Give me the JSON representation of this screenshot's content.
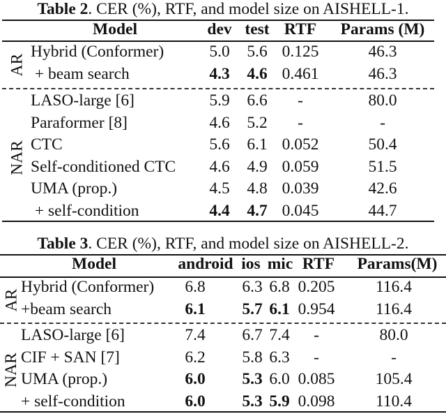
{
  "table2": {
    "caption_label": "Table 2",
    "caption_text": ". CER (%), RTF, and model size on AISHELL-1.",
    "headers": [
      "Model",
      "dev",
      "test",
      "RTF",
      "Params (M)"
    ],
    "groups": [
      {
        "label": "AR",
        "rows": [
          {
            "model": "Hybrid (Conformer)",
            "dev": "5.0",
            "test": "5.6",
            "rtf": "0.125",
            "params": "46.3",
            "bold": []
          },
          {
            "model": " + beam search",
            "dev": "4.3",
            "test": "4.6",
            "rtf": "0.461",
            "params": "46.3",
            "bold": [
              "dev",
              "test"
            ]
          }
        ]
      },
      {
        "label": "NAR",
        "rows": [
          {
            "model": "LASO-large [6]",
            "dev": "5.9",
            "test": "6.6",
            "rtf": "-",
            "params": "80.0",
            "bold": []
          },
          {
            "model": "Paraformer [8]",
            "dev": "4.6",
            "test": "5.2",
            "rtf": "-",
            "params": "-",
            "bold": []
          },
          {
            "model": "CTC",
            "dev": "5.6",
            "test": "6.1",
            "rtf": "0.052",
            "params": "50.4",
            "bold": []
          },
          {
            "model": "Self-conditioned CTC",
            "dev": "4.6",
            "test": "4.9",
            "rtf": "0.059",
            "params": "51.5",
            "bold": []
          },
          {
            "model": "UMA (prop.)",
            "dev": "4.5",
            "test": "4.8",
            "rtf": "0.039",
            "params": "42.6",
            "bold": []
          },
          {
            "model": " + self-condition",
            "dev": "4.4",
            "test": "4.7",
            "rtf": "0.045",
            "params": "44.7",
            "bold": [
              "dev",
              "test"
            ]
          }
        ]
      }
    ]
  },
  "table3": {
    "caption_label": "Table 3",
    "caption_text": ". CER (%), RTF, and model size on AISHELL-2.",
    "headers": [
      "Model",
      "android",
      "ios",
      "mic",
      "RTF",
      "Params(M)"
    ],
    "groups": [
      {
        "label": "AR",
        "rows": [
          {
            "model": "Hybrid (Conformer)",
            "android": "6.8",
            "ios": "6.3",
            "mic": "6.8",
            "rtf": "0.205",
            "params": "116.4",
            "bold": []
          },
          {
            "model": "+beam search",
            "android": "6.1",
            "ios": "5.7",
            "mic": "6.1",
            "rtf": "0.954",
            "params": "116.4",
            "bold": [
              "android",
              "ios",
              "mic"
            ]
          }
        ]
      },
      {
        "label": "NAR",
        "rows": [
          {
            "model": "LASO-large [6]",
            "android": "7.4",
            "ios": "6.7",
            "mic": "7.4",
            "rtf": "-",
            "params": "80.0",
            "bold": []
          },
          {
            "model": "CIF + SAN [7]",
            "android": "6.2",
            "ios": "5.8",
            "mic": "6.3",
            "rtf": "-",
            "params": "-",
            "bold": []
          },
          {
            "model": "UMA (prop.)",
            "android": "6.0",
            "ios": "5.3",
            "mic": "6.0",
            "rtf": "0.085",
            "params": "105.4",
            "bold": [
              "android",
              "ios"
            ]
          },
          {
            "model": "+ self-condition",
            "android": "6.0",
            "ios": "5.3",
            "mic": "5.9",
            "rtf": "0.098",
            "params": "110.4",
            "bold": [
              "android",
              "ios",
              "mic"
            ]
          }
        ]
      }
    ]
  }
}
